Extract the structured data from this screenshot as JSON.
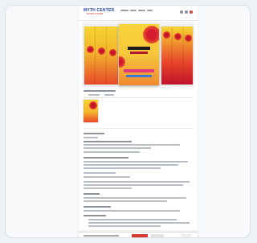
{
  "header": {
    "logo_text": "MYTH CENTER",
    "logo_sub": "BOOKS & MORE"
  },
  "colors": {
    "brand_blue": "#1e3fa8",
    "cover_yellow": "#f9d63a",
    "cover_red": "#d31a2f",
    "accent_pink": "#e43978",
    "cookie_accept": "#d43a2f"
  },
  "icons": [
    "search-icon",
    "user-icon",
    "cart-icon"
  ]
}
